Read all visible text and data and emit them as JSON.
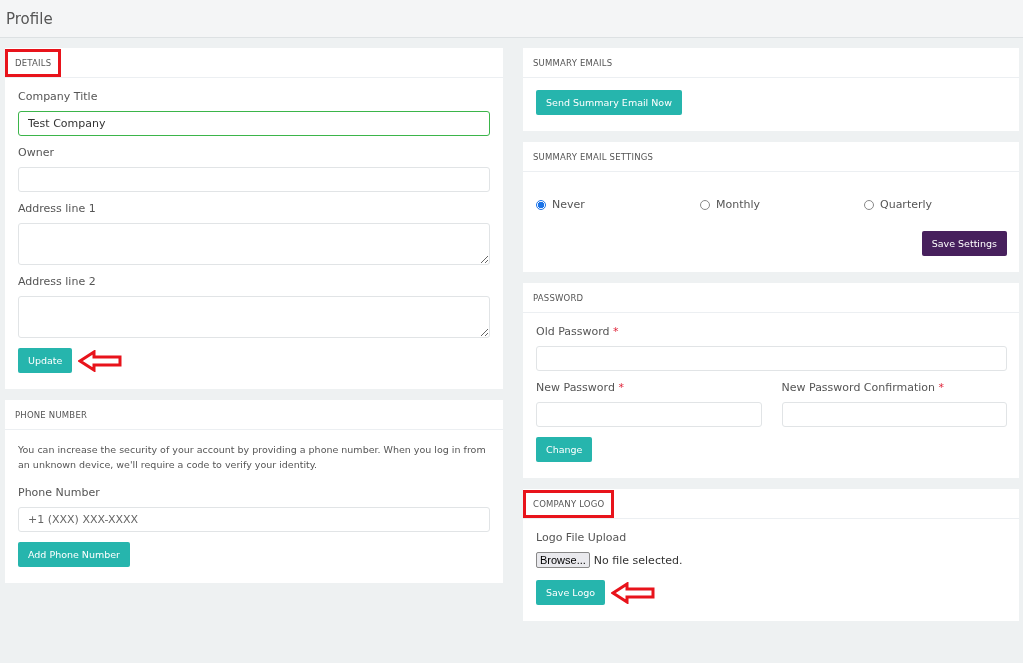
{
  "page_title": "Profile",
  "left": [
    {
      "kind": "form",
      "title": "DETAILS",
      "title_highlighted": true,
      "fields": [
        {
          "kind": "input",
          "label": "Company Title",
          "value": "Test Company",
          "focused": true
        },
        {
          "kind": "input",
          "label": "Owner",
          "focused": false
        },
        {
          "kind": "textarea",
          "label": "Address line 1",
          "focused": false
        },
        {
          "kind": "textarea",
          "label": "Address line 2",
          "focused": false
        }
      ],
      "button": {
        "label": "Update",
        "pointed": true
      }
    },
    {
      "kind": "form",
      "title": "PHONE NUMBER",
      "title_highlighted": false,
      "intro": "You can increase the security of your account by providing a phone number. When you log in from an unknown device, we'll require a code to verify your identity.",
      "fields": [
        {
          "kind": "input",
          "label": "Phone Number",
          "placeholder": "+1 (XXX) XXX-XXXX",
          "focused": false
        }
      ],
      "button": {
        "label": "Add Phone Number",
        "pointed": false
      }
    }
  ],
  "right": [
    {
      "kind": "action",
      "title": "SUMMARY EMAILS",
      "title_highlighted": false,
      "button": {
        "label": "Send Summary Email Now",
        "pointed": false
      }
    },
    {
      "kind": "radios",
      "title": "SUMMARY EMAIL SETTINGS",
      "title_highlighted": false,
      "options": [
        {
          "label": "Never",
          "selected": true
        },
        {
          "label": "Monthly",
          "selected": false
        },
        {
          "label": "Quarterly",
          "selected": false
        }
      ],
      "button": {
        "label": "Save Settings",
        "pointed": false
      }
    },
    {
      "kind": "password",
      "title": "PASSWORD",
      "title_highlighted": false,
      "fields": [
        {
          "label": "Old Password",
          "required": "*"
        },
        {
          "label": "New Password",
          "required": "*"
        },
        {
          "label": "New Password Confirmation",
          "required": "*"
        }
      ],
      "button": {
        "label": "Change",
        "pointed": false
      }
    },
    {
      "kind": "upload",
      "title": "COMPANY LOGO",
      "title_highlighted": true,
      "label": "Logo File Upload",
      "browse": "Browse...",
      "status": "No file selected.",
      "button": {
        "label": "Save Logo",
        "pointed": true
      }
    }
  ]
}
